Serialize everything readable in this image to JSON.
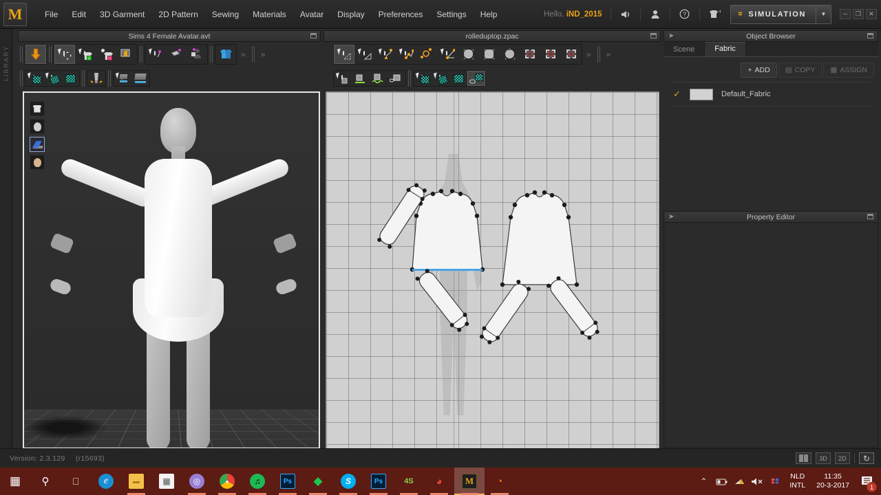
{
  "app": {
    "logo_letter": "M",
    "version_label": "Version: 2.3.129",
    "revision_label": "(r15693)",
    "library_rail_label": "LIBRARY"
  },
  "menubar": {
    "items": [
      {
        "label": "File"
      },
      {
        "label": "Edit"
      },
      {
        "label": "3D Garment"
      },
      {
        "label": "2D Pattern"
      },
      {
        "label": "Sewing"
      },
      {
        "label": "Materials"
      },
      {
        "label": "Avatar"
      },
      {
        "label": "Display"
      },
      {
        "label": "Preferences"
      },
      {
        "label": "Settings"
      },
      {
        "label": "Help"
      }
    ],
    "greeting_prefix": "Hello,",
    "user_name": "iND_2015",
    "icons": [
      "speaker-icon",
      "user-icon",
      "help-icon",
      "garment-add-icon"
    ],
    "simulation_button": {
      "label": "SIMULATION",
      "chevron": "»",
      "dropdown_arrow": "▼"
    },
    "window_buttons": [
      {
        "name": "minimize-button",
        "glyph": "─"
      },
      {
        "name": "restore-button",
        "glyph": "❐"
      },
      {
        "name": "close-button",
        "glyph": "✕"
      }
    ]
  },
  "panels": {
    "avatar_title": "Sims 4 Female Avatar.avt",
    "garment_title": "rolleduptop.zpac"
  },
  "toolbar3d": {
    "row1": [
      {
        "name": "simulate-arrow-tool",
        "icon": "orange-down-arrow-icon"
      },
      {
        "name": "select-move-tool",
        "icon": "select-move-icon"
      },
      {
        "name": "select-mesh-tool",
        "icon": "green-mesh-shirt-icon"
      },
      {
        "name": "select-pattern-tool",
        "icon": "pink-mesh-shirt-icon"
      },
      {
        "name": "fold-arrange-tool",
        "icon": "fold-screen-icon"
      },
      {
        "name": "pin-tool",
        "icon": "pin-icon"
      },
      {
        "name": "box-pin-tool",
        "icon": "box-pin-icon"
      },
      {
        "name": "avatar-pin-tool",
        "icon": "avatar-pin-icon"
      },
      {
        "name": "arrangement-tool",
        "icon": "blue-garment-icon"
      }
    ],
    "row2": [
      {
        "name": "texture-select-tool",
        "icon": "texture-cursor-icon"
      },
      {
        "name": "texture-edit-tool",
        "icon": "texture-edit-icon"
      },
      {
        "name": "texture-pattern-tool",
        "icon": "texture-pattern-icon"
      },
      {
        "name": "zipper-tool",
        "icon": "zipper-icon"
      },
      {
        "name": "panel-select-tool",
        "icon": "panel-cursor-icon"
      },
      {
        "name": "panel-plane-tool",
        "icon": "panel-plane-icon"
      }
    ],
    "more_glyph": "»"
  },
  "toolbar2d": {
    "row1": [
      {
        "name": "edit-pattern-tool",
        "icon": "edit-pattern-icon"
      },
      {
        "name": "edit-curve-point-tool",
        "icon": "edit-curve-point-icon"
      },
      {
        "name": "edit-curvature-tool",
        "icon": "edit-curvature-icon"
      },
      {
        "name": "add-point-tool",
        "icon": "add-point-icon"
      },
      {
        "name": "move-point-tool",
        "icon": "move-point-icon"
      },
      {
        "name": "polygon-tool",
        "icon": "polygon-icon"
      },
      {
        "name": "create-shape-tool",
        "icon": "create-shape-icon"
      },
      {
        "name": "rectangle-tool",
        "icon": "rectangle-icon"
      },
      {
        "name": "circle-tool",
        "icon": "circle-icon"
      },
      {
        "name": "internal-shape-tool",
        "icon": "internal-shape-icon"
      },
      {
        "name": "internal-rectangle-tool",
        "icon": "internal-rectangle-icon"
      },
      {
        "name": "internal-circle-tool",
        "icon": "internal-circle-icon"
      }
    ],
    "row2": [
      {
        "name": "sew-select-tool",
        "icon": "sew-cursor-icon"
      },
      {
        "name": "segment-sew-tool",
        "icon": "segment-sew-icon"
      },
      {
        "name": "free-sew-tool",
        "icon": "free-sew-icon"
      },
      {
        "name": "sew-edit-tool",
        "icon": "sew-edit-icon"
      },
      {
        "name": "texture-select-2d-tool",
        "icon": "texture-cursor-icon"
      },
      {
        "name": "texture-edit-2d-tool",
        "icon": "texture-edit-icon"
      },
      {
        "name": "texture-pattern-2d-tool",
        "icon": "texture-pattern-icon"
      },
      {
        "name": "texture-adjust-tool",
        "icon": "texture-adjust-icon"
      }
    ],
    "more_glyph": "»"
  },
  "view3d": {
    "overlay_icons": [
      {
        "name": "show-garment-toggle",
        "icon": "garment-icon",
        "active": false
      },
      {
        "name": "show-avatar-toggle",
        "icon": "avatar-head-icon",
        "active": false
      },
      {
        "name": "show-fold-toggle",
        "icon": "fold-arrange-icon",
        "active": true
      },
      {
        "name": "show-skin-toggle",
        "icon": "skin-head-icon",
        "active": false
      }
    ]
  },
  "object_browser": {
    "title": "Object Browser",
    "tabs": [
      {
        "label": "Scene",
        "selected": false
      },
      {
        "label": "Fabric",
        "selected": true
      }
    ],
    "buttons": [
      {
        "label": "ADD",
        "icon": "plus-icon",
        "enabled": true
      },
      {
        "label": "COPY",
        "icon": "copy-icon",
        "enabled": false
      },
      {
        "label": "ASSIGN",
        "icon": "assign-icon",
        "enabled": false
      }
    ],
    "fabrics": [
      {
        "name": "Default_Fabric",
        "checked": true,
        "swatch_color": "#d2d2d2"
      }
    ]
  },
  "property_editor": {
    "title": "Property Editor"
  },
  "statusbar": {
    "buttons": [
      {
        "name": "split-view-button",
        "label": ""
      },
      {
        "name": "view-3d-button",
        "label": "3D"
      },
      {
        "name": "view-2d-button",
        "label": "2D"
      },
      {
        "name": "reset-view-button",
        "label": "↻"
      }
    ]
  },
  "taskbar": {
    "items": [
      {
        "name": "start-button",
        "icon": "windows-logo-icon",
        "glyph": "⊞",
        "color": "#ffffff",
        "bg": "transparent",
        "running": false,
        "active": false
      },
      {
        "name": "search-button",
        "icon": "search-icon",
        "glyph": "⚲",
        "color": "#ffffff",
        "bg": "transparent",
        "running": false,
        "active": false
      },
      {
        "name": "task-view-button",
        "icon": "task-view-icon",
        "glyph": "□",
        "color": "#ffffff",
        "bg": "transparent",
        "running": false,
        "active": false
      },
      {
        "name": "edge-button",
        "icon": "edge-icon",
        "glyph": "e",
        "color": "#2196d9",
        "bg": "transparent",
        "running": false,
        "active": false
      },
      {
        "name": "file-explorer-button",
        "icon": "folder-icon",
        "glyph": "▬",
        "color": "#f5c23e",
        "bg": "transparent",
        "running": true,
        "active": false
      },
      {
        "name": "store-button",
        "icon": "store-icon",
        "glyph": "▤",
        "color": "#ffffff",
        "bg": "transparent",
        "running": false,
        "active": false
      },
      {
        "name": "bittorrent-button",
        "icon": "bittorrent-icon",
        "glyph": "◎",
        "color": "#9a7fd4",
        "bg": "transparent",
        "running": true,
        "active": false
      },
      {
        "name": "chrome-button",
        "icon": "chrome-icon",
        "glyph": "●",
        "color": "#e8453c",
        "bg": "transparent",
        "running": true,
        "active": false
      },
      {
        "name": "spotify-button",
        "icon": "spotify-icon",
        "glyph": "♫",
        "color": "#1db954",
        "bg": "transparent",
        "running": true,
        "active": false
      },
      {
        "name": "photoshop-button",
        "icon": "photoshop-icon",
        "glyph": "Ps",
        "color": "#31a8ff",
        "bg": "#001e36",
        "running": true,
        "active": false
      },
      {
        "name": "sims-button",
        "icon": "sims-plumbob-icon",
        "glyph": "◆",
        "color": "#1ec54f",
        "bg": "transparent",
        "running": true,
        "active": false
      },
      {
        "name": "skype-button",
        "icon": "skype-icon",
        "glyph": "S",
        "color": "#00aff0",
        "bg": "transparent",
        "running": true,
        "active": false
      },
      {
        "name": "photoshop-2-button",
        "icon": "photoshop-icon",
        "glyph": "Ps",
        "color": "#31a8ff",
        "bg": "#001e36",
        "running": true,
        "active": false
      },
      {
        "name": "sims4studio-button",
        "icon": "sims4studio-icon",
        "glyph": "4S",
        "color": "#7ac943",
        "bg": "transparent",
        "running": true,
        "active": false
      },
      {
        "name": "acrobat-button",
        "icon": "acrobat-icon",
        "glyph": "◗",
        "color": "#e8453c",
        "bg": "transparent",
        "running": true,
        "active": false
      },
      {
        "name": "marvelous-designer-button",
        "icon": "marvelous-designer-icon",
        "glyph": "M",
        "color": "#e8a317",
        "bg": "#1f1f1f",
        "running": true,
        "active": true
      },
      {
        "name": "blender-button",
        "icon": "blender-icon",
        "glyph": "◔",
        "color": "#ea7600",
        "bg": "transparent",
        "running": true,
        "active": false
      }
    ],
    "tray": {
      "icons": [
        {
          "name": "show-hidden-icons-button",
          "glyph": "⌃"
        },
        {
          "name": "battery-icon",
          "glyph": "▭"
        },
        {
          "name": "wifi-warning-icon",
          "glyph": "◢"
        },
        {
          "name": "volume-muted-icon",
          "glyph": "🔇"
        },
        {
          "name": "dropbox-icon",
          "glyph": "◆"
        }
      ],
      "language_line1": "NLD",
      "language_line2": "INTL",
      "time": "11:35",
      "date": "20-3-2017",
      "notification_count": "1"
    }
  },
  "pattern_pieces": [
    {
      "name": "front-bodice-panel",
      "type": "bodice"
    },
    {
      "name": "back-bodice-panel",
      "type": "bodice"
    },
    {
      "name": "sleeve-upper-left",
      "type": "sleeve"
    },
    {
      "name": "sleeve-lower-left",
      "type": "sleeve"
    },
    {
      "name": "sleeve-lower-center",
      "type": "sleeve"
    },
    {
      "name": "sleeve-lower-right",
      "type": "sleeve"
    }
  ],
  "selection": {
    "highlighted_segment_color": "#4aa3e8"
  }
}
